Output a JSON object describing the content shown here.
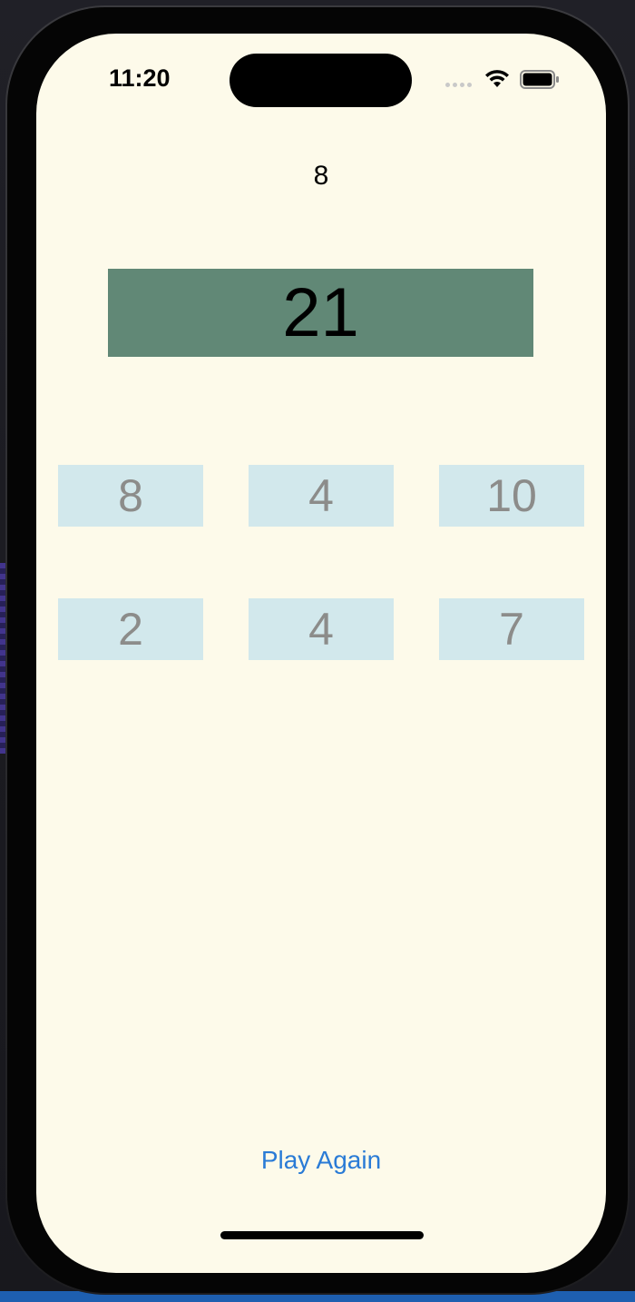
{
  "status_bar": {
    "time": "11:20"
  },
  "game": {
    "counter": "8",
    "target": "21",
    "tiles": [
      "8",
      "4",
      "10",
      "2",
      "4",
      "7"
    ],
    "play_again_label": "Play Again"
  },
  "colors": {
    "background": "#fdfaea",
    "target_fill": "#618876",
    "tile_fill": "#d2e8ec",
    "tile_text": "#8c8c8a",
    "link": "#2a7bd6"
  }
}
